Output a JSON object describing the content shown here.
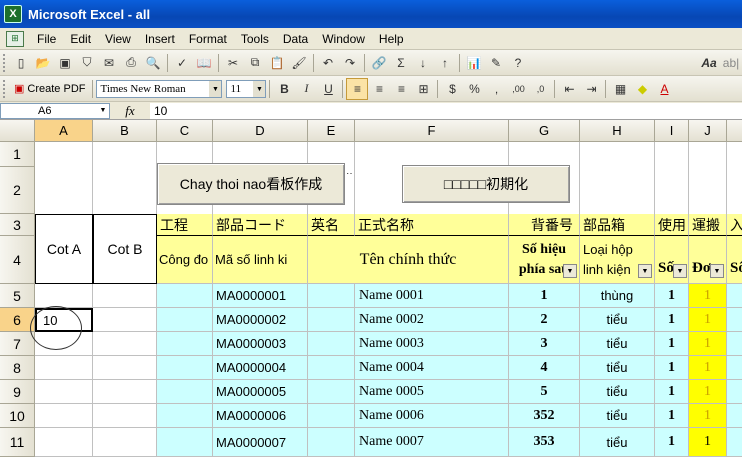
{
  "window": {
    "title": "Microsoft Excel - all",
    "app_icon": "excel-icon"
  },
  "menu": [
    "File",
    "Edit",
    "View",
    "Insert",
    "Format",
    "Tools",
    "Data",
    "Window",
    "Help"
  ],
  "toolbar": {
    "create_pdf": "Create PDF",
    "font": "Times New Roman",
    "size": "11",
    "bold": "B",
    "italic": "I",
    "underline": "U",
    "currency": "$",
    "percent": "%",
    "comma": ",",
    "inc_decimal": ",00",
    "dec_decimal": ",0"
  },
  "formula_bar": {
    "name_box": "A6",
    "fx": "fx",
    "value": "10"
  },
  "columns": [
    "A",
    "B",
    "C",
    "D",
    "E",
    "F",
    "G",
    "H",
    "I",
    "J"
  ],
  "rows": [
    "1",
    "2",
    "3",
    "4",
    "5",
    "6",
    "7",
    "8",
    "9",
    "10",
    "11"
  ],
  "active": {
    "col": "A",
    "row": "6"
  },
  "buttons": {
    "chay": "Chay thoi nao看板作成",
    "init": "□□□□□初期化"
  },
  "header3": {
    "c": "工程",
    "d": "部品コード",
    "e": "英名",
    "f": "正式名称",
    "g": "背番号",
    "h": "部品箱",
    "i": "使用",
    "j": "運搬",
    "k": "入"
  },
  "header4": {
    "a": "Cot A",
    "b": "Cot B",
    "c": "Công đo",
    "d": "Mã số linh ki",
    "f": "Tên chính thức",
    "g1": "Số hiệu",
    "g2": "phía sau",
    "h1": "Loại hộp",
    "h2": "linh kiện",
    "i": "Số",
    "j": "Đơ",
    "k": "Số"
  },
  "data_rows": [
    {
      "code": "MA0000001",
      "name": "Name 0001",
      "num": "1",
      "box": "thùng",
      "use": "1",
      "carry": "1"
    },
    {
      "code": "MA0000002",
      "name": "Name 0002",
      "num": "2",
      "box": "tiểu",
      "use": "1",
      "carry": "1"
    },
    {
      "code": "MA0000003",
      "name": "Name 0003",
      "num": "3",
      "box": "tiểu",
      "use": "1",
      "carry": "1"
    },
    {
      "code": "MA0000004",
      "name": "Name 0004",
      "num": "4",
      "box": "tiểu",
      "use": "1",
      "carry": "1"
    },
    {
      "code": "MA0000005",
      "name": "Name 0005",
      "num": "5",
      "box": "tiểu",
      "use": "1",
      "carry": "1"
    },
    {
      "code": "MA0000006",
      "name": "Name 0006",
      "num": "352",
      "box": "tiểu",
      "use": "1",
      "carry": "1"
    },
    {
      "code": "MA0000007",
      "name": "Name 0007",
      "num": "353",
      "box": "tiểu",
      "use": "1",
      "carry": "1"
    }
  ],
  "cell_a6": "10",
  "colors": {
    "header_yellow": "#ffff99",
    "data_cyan": "#ccffff",
    "carry_yellow": "#ffff00",
    "active_header": "#f9d38a"
  }
}
